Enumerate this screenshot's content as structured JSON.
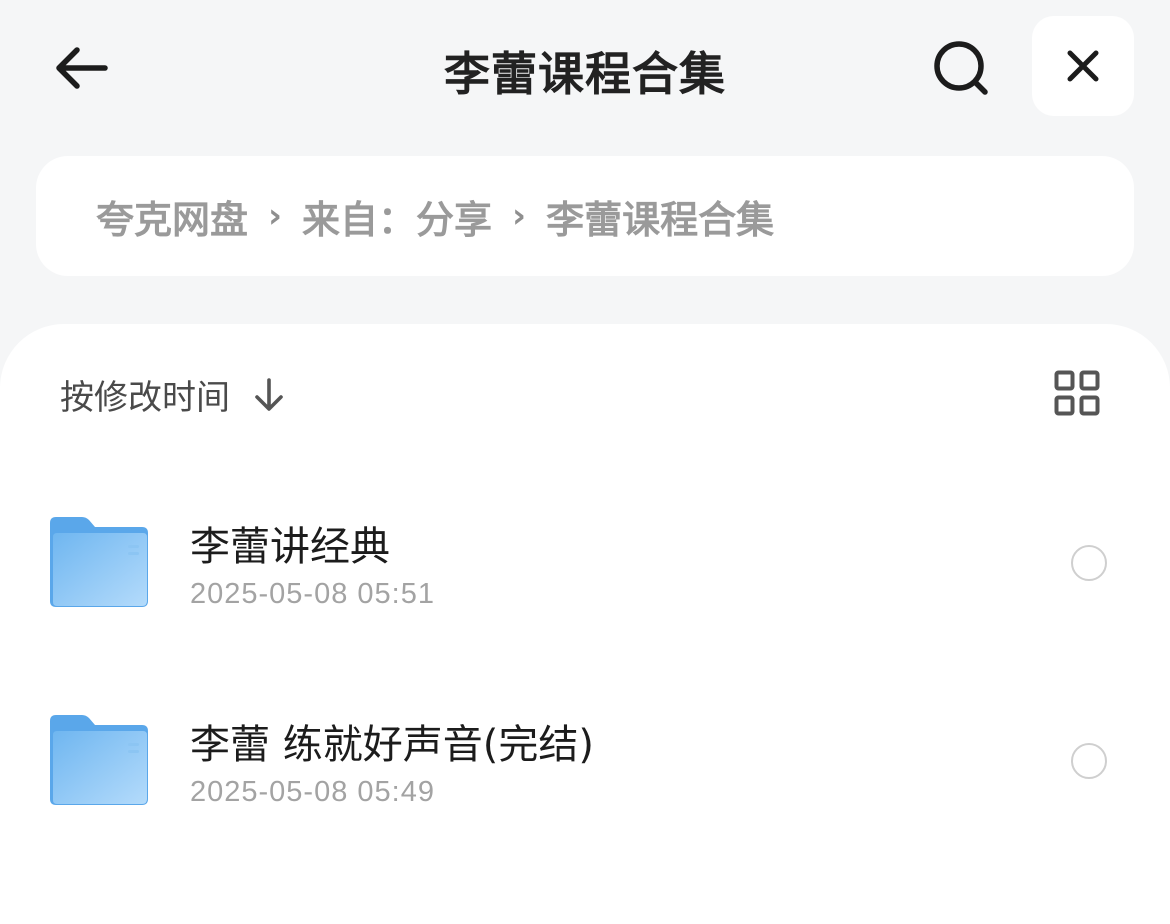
{
  "header": {
    "title": "李蕾课程合集",
    "back_icon": "arrow-left-icon",
    "search_icon": "search-icon",
    "close_icon": "close-icon"
  },
  "breadcrumb": {
    "items": [
      "夸克网盘",
      "来自：分享",
      "李蕾课程合集"
    ],
    "separator": "›"
  },
  "toolbar": {
    "sort_label": "按修改时间",
    "sort_icon": "arrow-down-icon",
    "view_icon": "grid-view-icon"
  },
  "files": [
    {
      "name": "李蕾讲经典",
      "date": "2025-05-08 05:51",
      "icon": "folder-icon"
    },
    {
      "name": "李蕾 练就好声音(完结)",
      "date": "2025-05-08 05:49",
      "icon": "folder-icon"
    }
  ],
  "colors": {
    "background": "#f5f6f7",
    "card": "#ffffff",
    "folder": "#7cc0f4",
    "muted_text": "#9a9a9a"
  }
}
